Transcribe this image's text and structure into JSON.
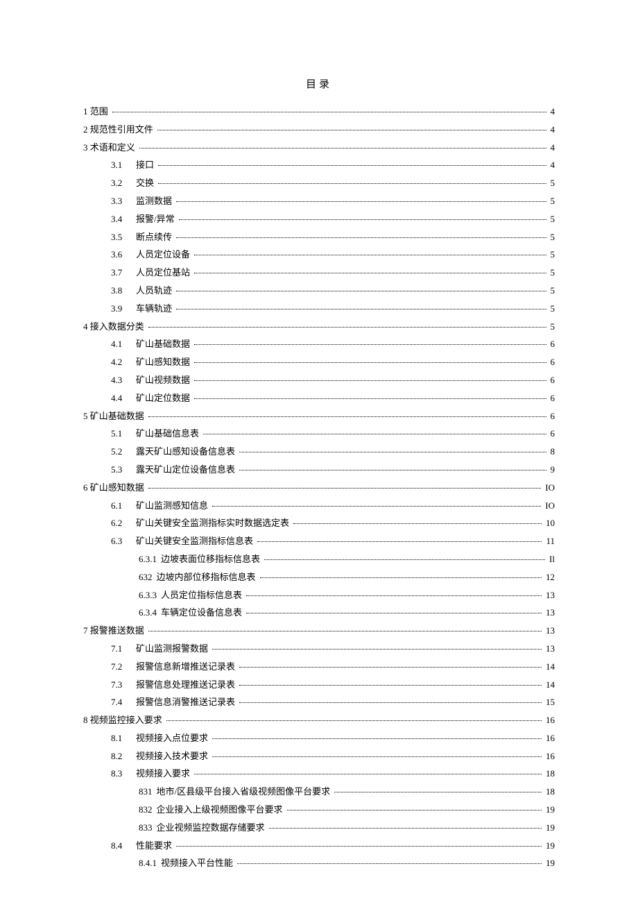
{
  "title": "目录",
  "toc": [
    {
      "level": 0,
      "num": "1",
      "label": "范围",
      "page": "4"
    },
    {
      "level": 0,
      "num": "2",
      "label": "规范性引用文件",
      "page": "4"
    },
    {
      "level": 0,
      "num": "3",
      "label": "术语和定义",
      "page": "4"
    },
    {
      "level": 1,
      "num": "3.1",
      "label": "接口",
      "page": "4"
    },
    {
      "level": 1,
      "num": "3.2",
      "label": "交换",
      "page": "5"
    },
    {
      "level": 1,
      "num": "3.3",
      "label": "监测数据",
      "page": "5"
    },
    {
      "level": 1,
      "num": "3.4",
      "label": "报警/异常",
      "page": "5"
    },
    {
      "level": 1,
      "num": "3.5",
      "label": "断点续传",
      "page": "5"
    },
    {
      "level": 1,
      "num": "3.6",
      "label": "人员定位设备",
      "page": "5"
    },
    {
      "level": 1,
      "num": "3.7",
      "label": "人员定位基站",
      "page": "5"
    },
    {
      "level": 1,
      "num": "3.8",
      "label": "人员轨迹",
      "page": "5"
    },
    {
      "level": 1,
      "num": "3.9",
      "label": "车辆轨迹",
      "page": "5"
    },
    {
      "level": 0,
      "num": "4",
      "label": "接入数据分类",
      "page": "5"
    },
    {
      "level": 1,
      "num": "4.1",
      "label": "矿山基础数据",
      "page": "6"
    },
    {
      "level": 1,
      "num": "4.2",
      "label": "矿山感知数据",
      "page": "6"
    },
    {
      "level": 1,
      "num": "4.3",
      "label": "矿山视频数据",
      "page": "6"
    },
    {
      "level": 1,
      "num": "4.4",
      "label": "矿山定位数据",
      "page": "6"
    },
    {
      "level": 0,
      "num": "5",
      "label": "矿山基础数据",
      "page": "6"
    },
    {
      "level": 1,
      "num": "5.1",
      "label": "矿山基础信息表",
      "page": "6"
    },
    {
      "level": 1,
      "num": "5.2",
      "label": "露天矿山感知设备信息表",
      "page": "8"
    },
    {
      "level": 1,
      "num": "5.3",
      "label": "露天矿山定位设备信息表",
      "page": "9"
    },
    {
      "level": 0,
      "num": "6",
      "label": "矿山感知数据",
      "page": "IO"
    },
    {
      "level": 1,
      "num": "6.1",
      "label": "矿山监测感知信息",
      "page": "IO"
    },
    {
      "level": 1,
      "num": "6.2",
      "label": "矿山关键安全监测指标实时数据选定表",
      "page": "10"
    },
    {
      "level": 1,
      "num": "6.3",
      "label": "矿山关键安全监测指标信息表",
      "page": "11"
    },
    {
      "level": 2,
      "num": "6.3.1",
      "label": "边坡表面位移指标信息表",
      "page": "Il"
    },
    {
      "level": 2,
      "num": "632",
      "label": "边坡内部位移指标信息表",
      "page": "12"
    },
    {
      "level": 2,
      "num": "6.3.3",
      "label": "人员定位指标信息表",
      "page": "13"
    },
    {
      "level": 2,
      "num": "6.3.4",
      "label": "车辆定位设备信息表",
      "page": "13"
    },
    {
      "level": 0,
      "num": "7",
      "label": "报警推送数据",
      "page": "13"
    },
    {
      "level": 1,
      "num": "7.1",
      "label": "矿山监测报警数据",
      "page": "13"
    },
    {
      "level": 1,
      "num": "7.2",
      "label": "报警信息新增推送记录表",
      "page": "14"
    },
    {
      "level": 1,
      "num": "7.3",
      "label": "报警信息处理推送记录表",
      "page": "14"
    },
    {
      "level": 1,
      "num": "7.4",
      "label": "报警信息消警推送记录表",
      "page": "15"
    },
    {
      "level": 0,
      "num": "8",
      "label": "视频监控接入要求",
      "page": "16"
    },
    {
      "level": 1,
      "num": "8.1",
      "label": "视频接入点位要求",
      "page": "16"
    },
    {
      "level": 1,
      "num": "8.2",
      "label": "视频接入技术要求",
      "page": "16"
    },
    {
      "level": 1,
      "num": "8.3",
      "label": "视频接入要求",
      "page": "18"
    },
    {
      "level": 2,
      "num": "831",
      "label": "地市/区县级平台接入省级视频图像平台要求",
      "page": "18"
    },
    {
      "level": 2,
      "num": "832",
      "label": "企业接入上级视频图像平台要求",
      "page": "19"
    },
    {
      "level": 2,
      "num": "833",
      "label": "企业视频监控数据存储要求",
      "page": "19"
    },
    {
      "level": 1,
      "num": "8.4",
      "label": "性能要求",
      "page": "19"
    },
    {
      "level": 2,
      "num": "8.4.1",
      "label": "视频接入平台性能",
      "page": "19"
    }
  ]
}
